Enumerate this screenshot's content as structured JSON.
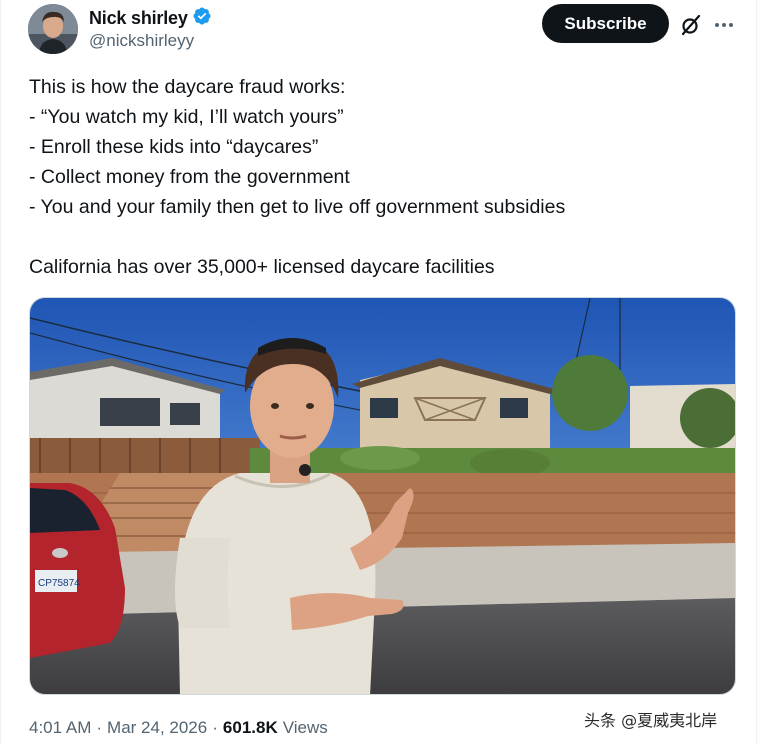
{
  "author": {
    "display_name": "Nick shirley",
    "handle": "@nickshirleyy",
    "verified": true
  },
  "actions": {
    "subscribe_label": "Subscribe",
    "grok_icon": "grok-slash-icon",
    "more_icon": "more-dots-icon"
  },
  "tweet": {
    "lines": [
      "This is how the daycare fraud works:",
      "- “You watch my kid, I’ll watch yours”",
      "- Enroll these kids into “daycares”",
      "- Collect money from the government",
      "- You and your family then get to live off government subsidies"
    ],
    "last_line": "California has over 35,000+ licensed daycare facilities"
  },
  "meta": {
    "time": "4:01 AM",
    "sep1": "·",
    "date": "Mar 24, 2026",
    "sep2": "·",
    "views_count": "601.8K",
    "views_label": "Views"
  },
  "watermark": "头条 @夏威夷北岸",
  "media": {
    "description_icon": "video-still-image",
    "car_plate": "CP75874"
  },
  "colors": {
    "text_primary": "#0f1419",
    "text_secondary": "#536471",
    "verified_blue": "#1d9bf0",
    "button_dark": "#0f1419"
  }
}
